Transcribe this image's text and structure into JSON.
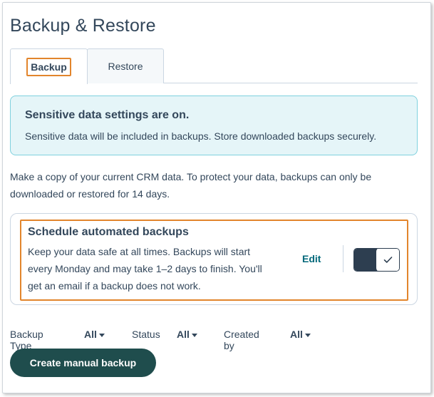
{
  "page": {
    "title": "Backup & Restore"
  },
  "tabs": [
    {
      "label": "Backup",
      "active": true
    },
    {
      "label": "Restore",
      "active": false
    }
  ],
  "alert": {
    "title": "Sensitive data settings are on.",
    "body": "Sensitive data will be included in backups. Store downloaded backups securely."
  },
  "intro": {
    "line1": "Make a copy of your current CRM data. To protect your data, backups can only be",
    "line2": "downloaded or restored for 14 days."
  },
  "schedule": {
    "title": "Schedule automated backups",
    "line1": "Keep your data safe at all times. Backups will start",
    "line2": "every Monday and may take 1–2 days to finish. You'll",
    "line3": "get an email if a backup does not work.",
    "edit_label": "Edit",
    "toggle_on": true
  },
  "filters": [
    {
      "label": "Backup Type",
      "value": "All"
    },
    {
      "label": "Status",
      "value": "All"
    },
    {
      "label": "Created by",
      "value": "All"
    }
  ],
  "actions": {
    "create_label": "Create manual backup"
  },
  "colors": {
    "accent_highlight": "#e2852c",
    "alert_bg": "#e5f5f8",
    "alert_border": "#7fd1de",
    "primary_button": "#1f4d4d",
    "link": "#00687a",
    "text": "#33475b"
  }
}
